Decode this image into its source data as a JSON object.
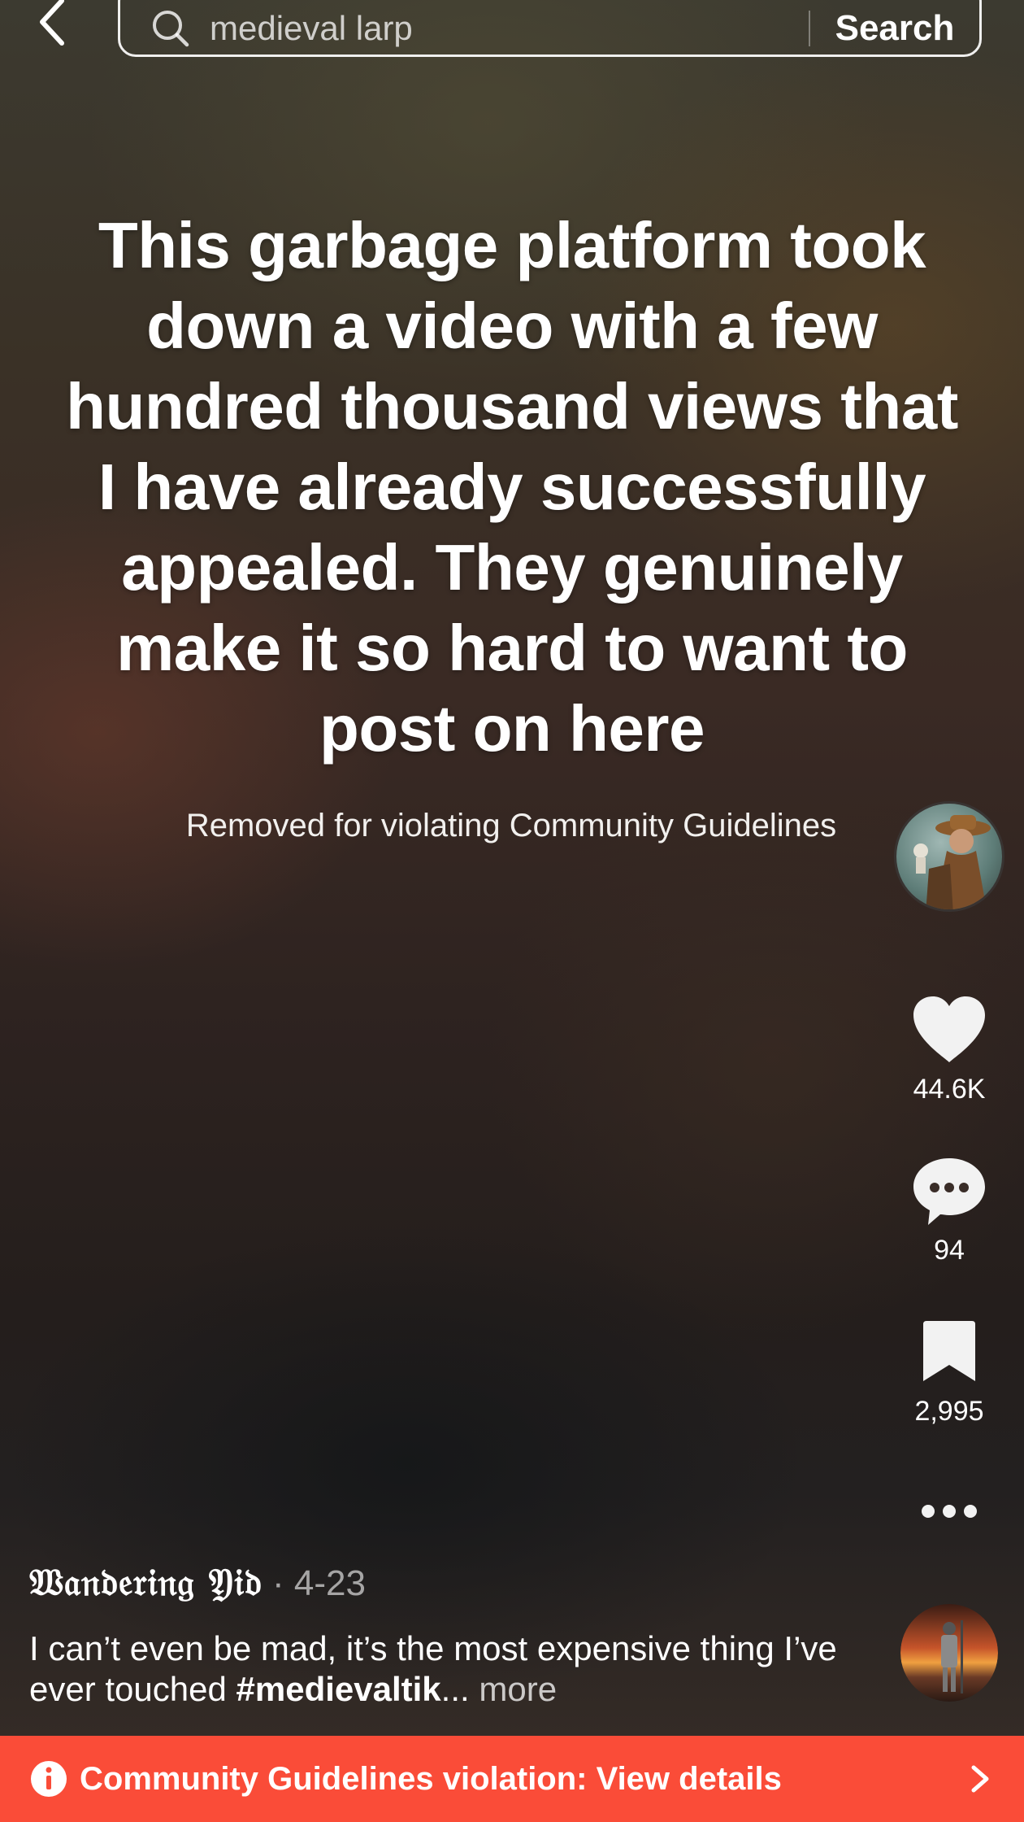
{
  "search": {
    "query": "medieval larp",
    "button_label": "Search"
  },
  "video": {
    "caption": "This garbage platform took down a video with a few hundred thousand views that I have already successfully appealed. They genuinely make it so hard to want to post on here",
    "status_text": "Removed for violating Community Guidelines"
  },
  "actions": {
    "likes": "44.6K",
    "comments": "94",
    "saves": "2,995"
  },
  "post": {
    "author": "𝔚𝔞𝔫𝔡𝔢𝔯𝔦𝔫𝔤 𝔜𝔦𝔡",
    "separator": " · ",
    "date": "4-23",
    "description": "I can’t even be mad, it’s the most expensive thing I’ve ever touched ",
    "hashtag": "#medievaltik",
    "ellipsis": "...",
    "more_label": " more"
  },
  "banner": {
    "text": "Community Guidelines violation: View details",
    "color": "#fa4c38"
  },
  "icons": {
    "back": "chevron-left-icon",
    "search": "magnifier-icon",
    "like": "heart-icon",
    "comment": "speech-bubble-icon",
    "save": "bookmark-icon",
    "more": "ellipsis-icon",
    "info": "info-icon",
    "chevron": "chevron-right-icon"
  }
}
